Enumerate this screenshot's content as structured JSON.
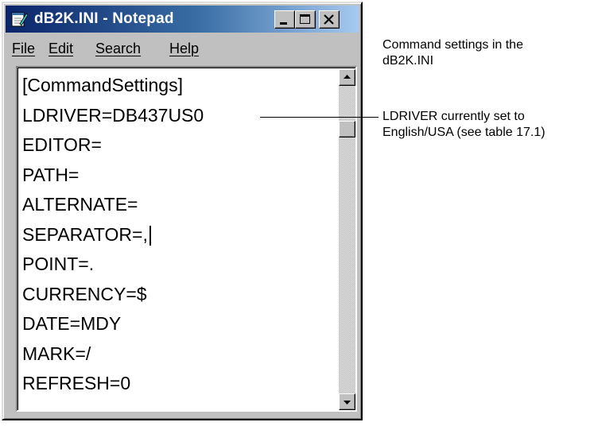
{
  "window": {
    "title": "dB2K.INI - Notepad",
    "icon": "notepad-icon",
    "controls": [
      "minimize-icon",
      "maximize-icon",
      "close-icon"
    ]
  },
  "menu": {
    "file": "File",
    "edit": "Edit",
    "search": "Search",
    "help": "Help"
  },
  "editor": {
    "lines": [
      "[CommandSettings]",
      "LDRIVER=DB437US0",
      "EDITOR=",
      "PATH=",
      "ALTERNATE=",
      "SEPARATOR=,",
      "POINT=.",
      "CURRENCY=$",
      "DATE=MDY",
      "MARK=/",
      "REFRESH=0"
    ]
  },
  "annotations": {
    "settings_note_line1": "Command settings in the",
    "settings_note_line2": "dB2K.INI",
    "ldriver_note_line1": "LDRIVER currently set to",
    "ldriver_note_line2": "English/USA (see table 17.1)"
  },
  "colors": {
    "titlebar_start": "#0a246a",
    "titlebar_end": "#a6caf0",
    "face": "#c0c0c0"
  }
}
